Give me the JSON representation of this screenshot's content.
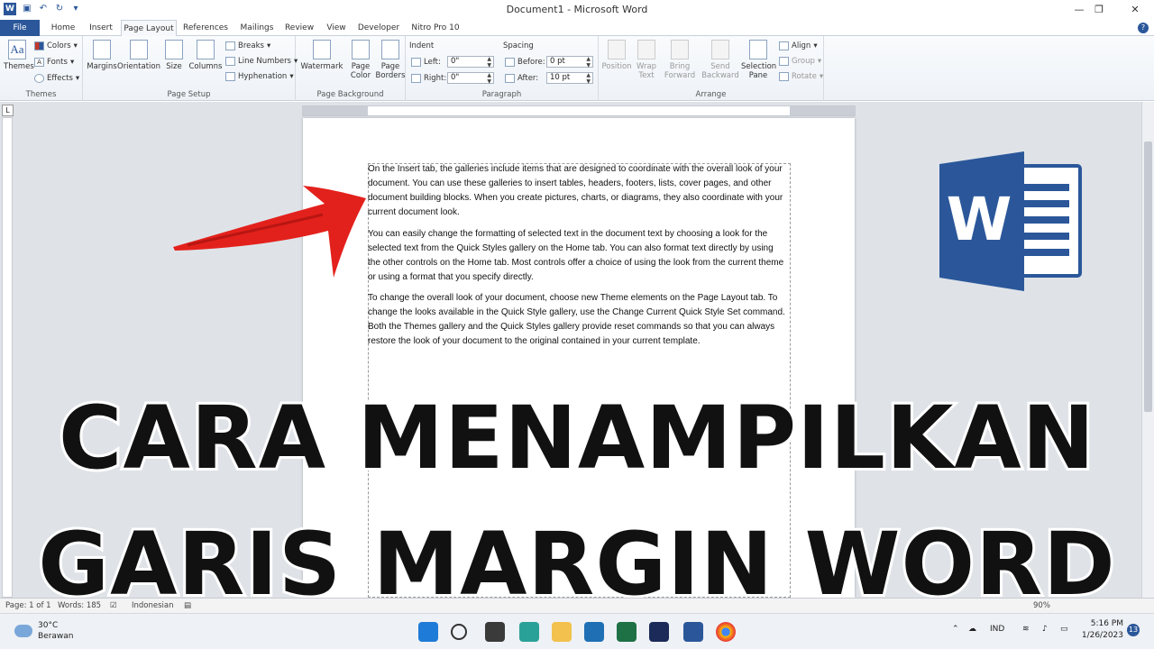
{
  "window": {
    "title": "Document1 - Microsoft Word",
    "minimize": "—",
    "restore": "❐",
    "close": "✕"
  },
  "tabs": [
    "File",
    "Home",
    "Insert",
    "Page Layout",
    "References",
    "Mailings",
    "Review",
    "View",
    "Developer",
    "Nitro Pro 10"
  ],
  "active_tab": "Page Layout",
  "ribbon": {
    "themes": {
      "themes": "Themes",
      "colors": "Colors",
      "fonts": "Fonts",
      "effects": "Effects",
      "label": "Themes"
    },
    "page_setup": {
      "margins": "Margins",
      "orientation": "Orientation",
      "size": "Size",
      "columns": "Columns",
      "breaks": "Breaks",
      "line_numbers": "Line Numbers",
      "hyphenation": "Hyphenation",
      "label": "Page Setup"
    },
    "page_background": {
      "watermark": "Watermark",
      "page_color_1": "Page",
      "page_color_2": "Color",
      "page_borders_1": "Page",
      "page_borders_2": "Borders",
      "label": "Page Background"
    },
    "paragraph": {
      "indent": "Indent",
      "left": "Left:",
      "left_value": "0\"",
      "right": "Right:",
      "right_value": "0\"",
      "spacing": "Spacing",
      "before": "Before:",
      "before_value": "0 pt",
      "after": "After:",
      "after_value": "10 pt",
      "label": "Paragraph"
    },
    "arrange": {
      "position": "Position",
      "wrap_1": "Wrap",
      "wrap_2": "Text",
      "bring_1": "Bring",
      "bring_2": "Forward",
      "send_1": "Send",
      "send_2": "Backward",
      "selection_1": "Selection",
      "selection_2": "Pane",
      "align": "Align",
      "group": "Group",
      "rotate": "Rotate",
      "label": "Arrange"
    }
  },
  "document": {
    "paragraphs": [
      "On the Insert tab, the galleries include items that are designed to coordinate with the overall look of your document. You can use these galleries to insert tables, headers, footers, lists, cover pages, and other document building blocks. When you create pictures, charts, or diagrams, they also coordinate with your current document look.",
      "You can easily change the formatting of selected text in the document text by choosing a look for the selected text from the Quick Styles gallery on the Home tab. You can also format text directly by using the other controls on the Home tab. Most controls offer a choice of using the look from the current theme or using a format that you specify directly.",
      "To change the overall look of your document, choose new Theme elements on the Page Layout tab. To change the looks available in the Quick Style gallery, use the Change Current Quick Style Set command. Both the Themes gallery and the Quick Styles gallery provide reset commands so that you can always restore the look of your document to the original contained in your current template."
    ]
  },
  "overlay": {
    "line1": "CARA MENAMPILKAN",
    "line2": "GARIS MARGIN WORD",
    "logo_letter": "W"
  },
  "statusbar": {
    "page": "Page: 1 of 1",
    "words": "Words: 185",
    "language": "Indonesian",
    "zoom": "90%"
  },
  "taskbar": {
    "temperature": "30°C",
    "weather": "Berawan",
    "lang": "IND",
    "time": "5:16 PM",
    "date": "1/26/2023",
    "notifications": "13"
  },
  "colors": {
    "word_blue": "#2b579a",
    "arrow_red": "#e3211c"
  }
}
